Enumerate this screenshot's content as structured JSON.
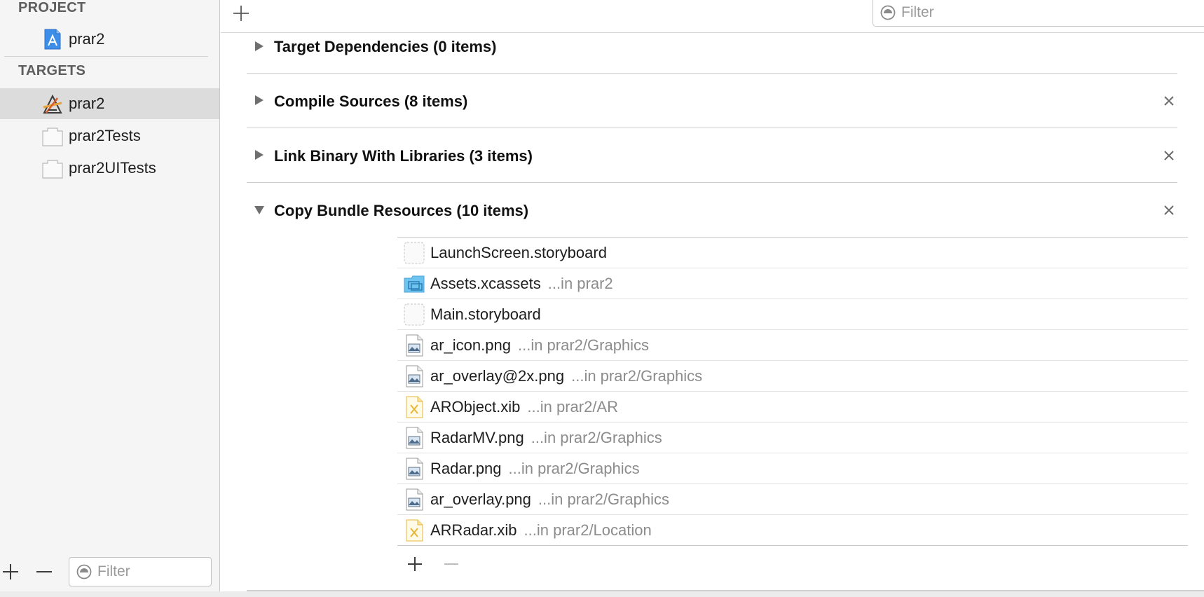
{
  "sidebar": {
    "project_header": "PROJECT",
    "project_item": "prar2",
    "targets_header": "TARGETS",
    "targets": [
      {
        "label": "prar2",
        "icon": "app-target-icon",
        "selected": true
      },
      {
        "label": "prar2Tests",
        "icon": "test-bundle-icon",
        "selected": false
      },
      {
        "label": "prar2UITests",
        "icon": "test-bundle-icon",
        "selected": false
      }
    ],
    "filter_placeholder": "Filter"
  },
  "toolbar": {
    "filter_placeholder": "Filter"
  },
  "phases": [
    {
      "title": "Target Dependencies (0 items)",
      "expanded": false,
      "removable": false
    },
    {
      "title": "Compile Sources (8 items)",
      "expanded": false,
      "removable": true
    },
    {
      "title": "Link Binary With Libraries (3 items)",
      "expanded": false,
      "removable": true
    },
    {
      "title": "Copy Bundle Resources (10 items)",
      "expanded": true,
      "removable": true
    }
  ],
  "resources": [
    {
      "name": "LaunchScreen.storyboard",
      "location": "",
      "icon": "storyboard-icon"
    },
    {
      "name": "Assets.xcassets",
      "location": "...in prar2",
      "icon": "asset-folder-icon"
    },
    {
      "name": "Main.storyboard",
      "location": "",
      "icon": "storyboard-icon"
    },
    {
      "name": "ar_icon.png",
      "location": "...in prar2/Graphics",
      "icon": "image-file-icon"
    },
    {
      "name": "ar_overlay@2x.png",
      "location": "...in prar2/Graphics",
      "icon": "image-file-icon"
    },
    {
      "name": "ARObject.xib",
      "location": "...in prar2/AR",
      "icon": "xib-file-icon"
    },
    {
      "name": "RadarMV.png",
      "location": "...in prar2/Graphics",
      "icon": "image-file-icon"
    },
    {
      "name": "Radar.png",
      "location": "...in prar2/Graphics",
      "icon": "image-file-icon"
    },
    {
      "name": "ar_overlay.png",
      "location": "...in prar2/Graphics",
      "icon": "image-file-icon"
    },
    {
      "name": "ARRadar.xib",
      "location": "...in prar2/Location",
      "icon": "xib-file-icon"
    }
  ],
  "colors": {
    "selection": "#dcdcdc",
    "asset_folder": "#6fc3ef",
    "xib_accent": "#e8b73a",
    "section_header": "#5e5e5e"
  }
}
